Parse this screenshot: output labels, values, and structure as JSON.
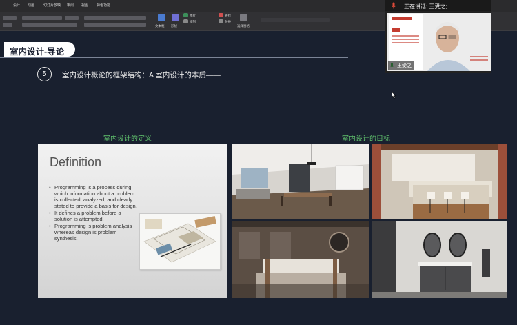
{
  "ribbon": {
    "menus": [
      "设计",
      "动画",
      "幻灯片放映",
      "审阅",
      "视图",
      "特色功能"
    ],
    "buttons": [
      "文本框",
      "形状",
      "图片",
      "排列",
      "查找",
      "替换",
      "选择窗格"
    ],
    "colors": {
      "menubar": "#2b2b2d",
      "ribbon": "#313134"
    }
  },
  "slide": {
    "section_title": "室内设计-导论",
    "item_number": "5",
    "heading": "室内设计概论的框架结构：A 室内设计的本质——",
    "left_label": "室内设计的定义",
    "right_label": "室内设计的目标",
    "accent_color": "#5fbf6c",
    "definition": {
      "title": "Definition",
      "bullets": [
        "Programming is a process during which information about a problem is collected, analyzed, and clearly stated to provide a basis for design.",
        "It defines a problem before a solution is attempted.",
        "Programming is problem analysis whereas design is problem synthesis."
      ]
    },
    "photos": [
      "living-dining-room",
      "kitchen",
      "bedroom",
      "bathroom"
    ]
  },
  "webinar": {
    "speaking_label": "正在讲话: 王受之;",
    "speaker_name": "王受之"
  }
}
